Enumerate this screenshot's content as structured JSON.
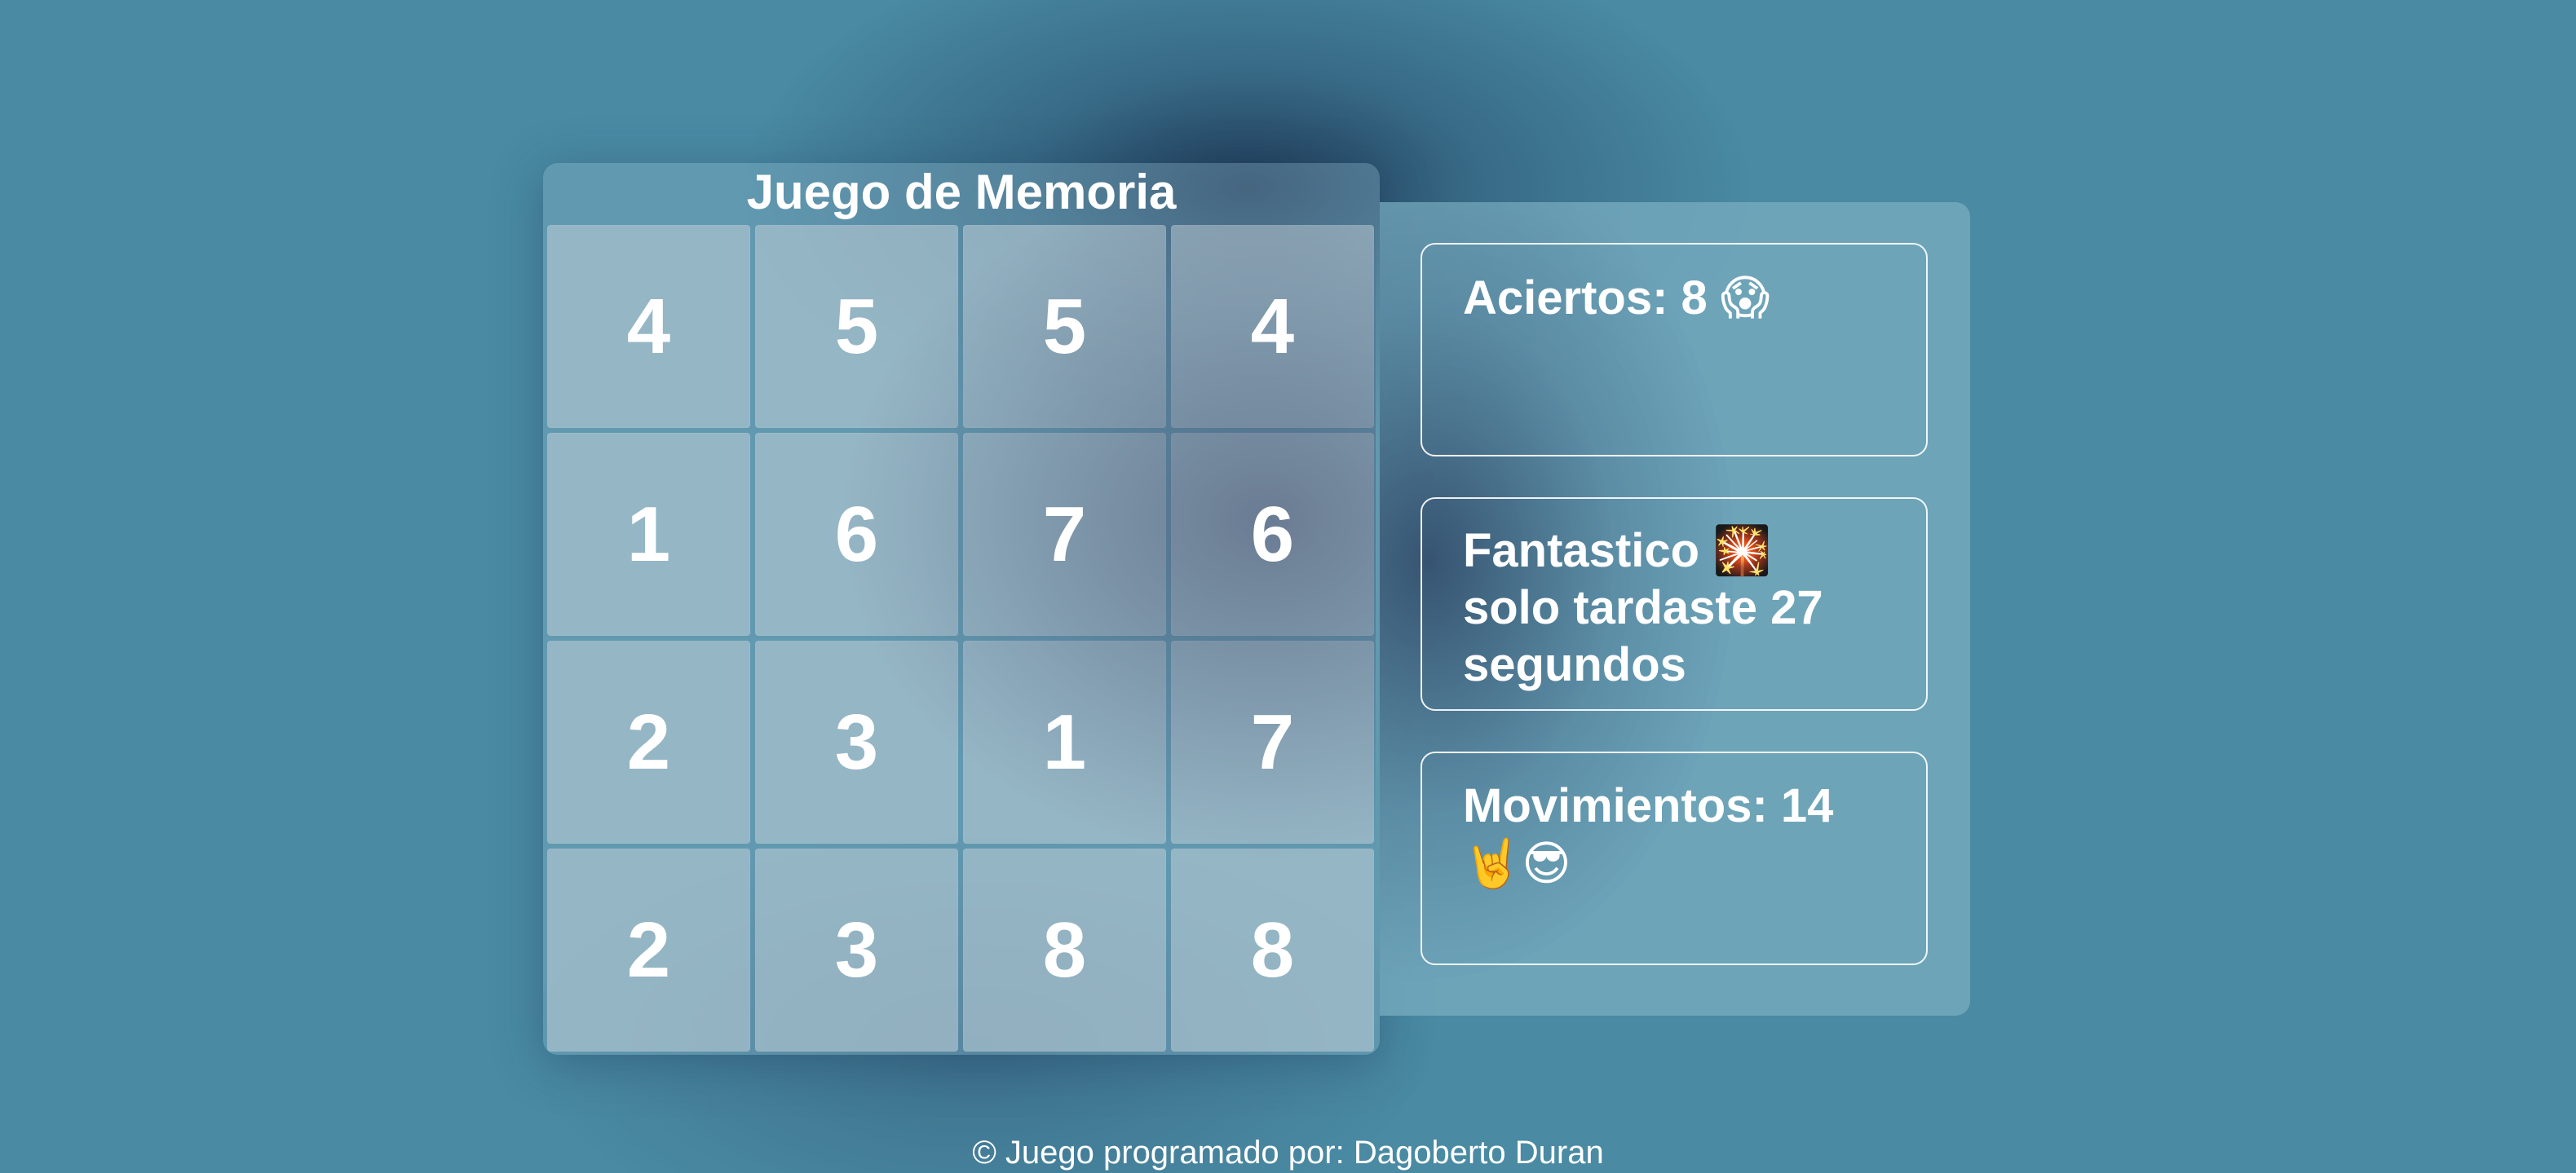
{
  "game": {
    "title": "Juego de Memoria",
    "tiles": [
      "4",
      "5",
      "5",
      "4",
      "1",
      "6",
      "7",
      "6",
      "2",
      "3",
      "1",
      "7",
      "2",
      "3",
      "8",
      "8"
    ]
  },
  "stats": {
    "hits_label": "Aciertos: 8",
    "hits_emoji": "😱",
    "result_line1": "Fantastico",
    "result_emoji": "🎇",
    "result_line2": "solo tardaste 27",
    "result_line3": "segundos",
    "moves_label": "Movimientos: 14",
    "moves_emoji": "🤘😎"
  },
  "footer": {
    "credit": "© Juego programado por: Dagoberto Duran"
  },
  "colors": {
    "background": "#4a8aa3",
    "text": "#ffffff"
  }
}
